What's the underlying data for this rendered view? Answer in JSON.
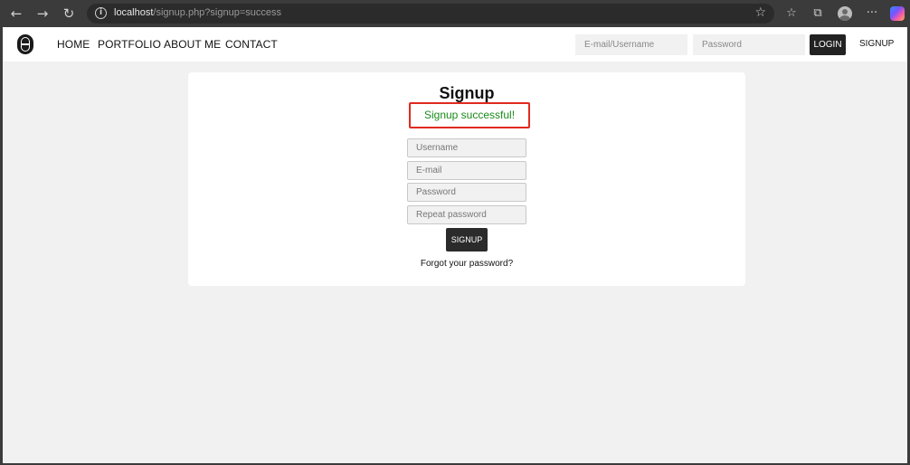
{
  "browser": {
    "url_host": "localhost",
    "url_path": "/signup.php?signup=success"
  },
  "nav": {
    "items": [
      "HOME",
      "PORTFOLIO",
      "ABOUT ME",
      "CONTACT"
    ]
  },
  "header_login": {
    "email_placeholder": "E-mail/Username",
    "password_placeholder": "Password",
    "login_label": "LOGIN",
    "signup_label": "SIGNUP"
  },
  "signup_form": {
    "title": "Signup",
    "success_message": "Signup successful!",
    "username_placeholder": "Username",
    "email_placeholder": "E-mail",
    "password_placeholder": "Password",
    "repeat_password_placeholder": "Repeat password",
    "submit_label": "SIGNUP",
    "forgot_label": "Forgot your password?"
  },
  "colors": {
    "success_text": "#1a8a1a",
    "highlight_border": "#e02a1e",
    "button_dark": "#222222"
  }
}
